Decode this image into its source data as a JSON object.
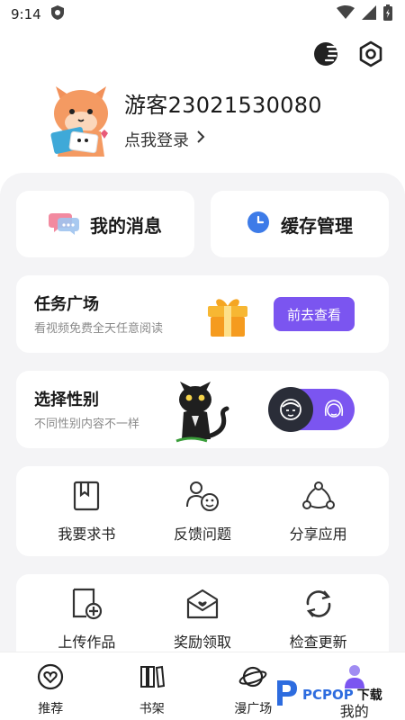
{
  "status_bar": {
    "time": "9:14"
  },
  "profile": {
    "username": "游客23021530080",
    "login_label": "点我登录"
  },
  "quick": {
    "messages_label": "我的消息",
    "cache_label": "缓存管理"
  },
  "task": {
    "title": "任务广场",
    "subtitle": "看视频免费全天任意阅读",
    "button_label": "前去查看"
  },
  "gender": {
    "title": "选择性别",
    "subtitle": "不同性别内容不一样",
    "selected": "male"
  },
  "grid1": [
    {
      "label": "我要求书",
      "icon": "book-icon"
    },
    {
      "label": "反馈问题",
      "icon": "feedback-icon"
    },
    {
      "label": "分享应用",
      "icon": "share-icon"
    }
  ],
  "grid2": [
    {
      "label": "上传作品",
      "icon": "upload-icon"
    },
    {
      "label": "奖励领取",
      "icon": "reward-mail-icon"
    },
    {
      "label": "检查更新",
      "icon": "refresh-icon"
    }
  ],
  "bottom_nav": [
    {
      "label": "推荐",
      "icon": "heart-icon"
    },
    {
      "label": "书架",
      "icon": "bookshelf-icon"
    },
    {
      "label": "漫广场",
      "icon": "planet-icon"
    },
    {
      "label": "我的",
      "icon": "user-icon",
      "active": true
    }
  ],
  "watermark": {
    "brand": "PCPOP",
    "suffix": "下载"
  },
  "colors": {
    "accent": "#7b55f0",
    "panel_bg": "#f4f4f6",
    "knob": "#2a2d38"
  }
}
